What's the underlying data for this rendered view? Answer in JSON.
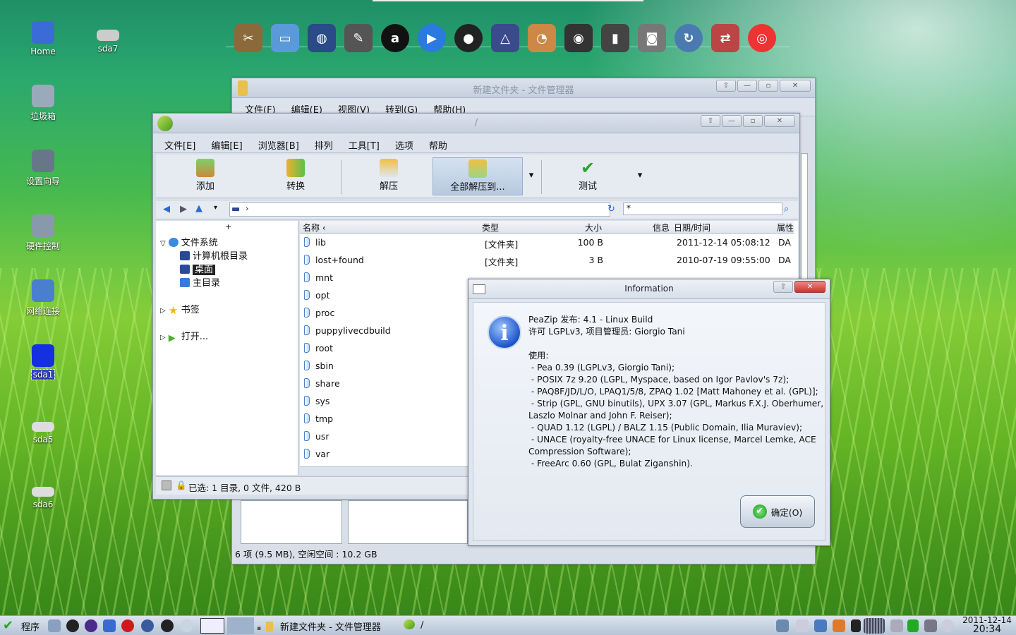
{
  "desktop": {
    "icons": [
      {
        "label": "Home"
      },
      {
        "label": "sda7"
      },
      {
        "label": "垃圾箱"
      },
      {
        "label": "设置向导"
      },
      {
        "label": "硬件控制"
      },
      {
        "label": "网络连接"
      },
      {
        "label": "sda1"
      },
      {
        "label": "sda5"
      },
      {
        "label": "sda6"
      }
    ]
  },
  "file_manager": {
    "title": "新建文件夹 - 文件管理器",
    "menu": [
      "文件(F)",
      "编辑(E)",
      "视图(V)",
      "转到(G)",
      "帮助(H)"
    ],
    "status": "6 项 (9.5 MB), 空闲空间 : 10.2 GB"
  },
  "peazip": {
    "title": "/",
    "menu": [
      "文件[E]",
      "编辑[E]",
      "浏览器[B]",
      "排列",
      "工具[T]",
      "选项",
      "帮助"
    ],
    "toolbar": {
      "add": "添加",
      "convert": "转换",
      "extract": "解压",
      "extract_all": "全部解压到...",
      "test": "测试"
    },
    "filter": "*",
    "tree": {
      "filesystem": "文件系统",
      "root": "计算机根目录",
      "desktop": "桌面",
      "home": "主目录",
      "bookmarks": "书签",
      "open": "打开..."
    },
    "columns": {
      "name": "名称 ‹",
      "type": "类型",
      "size": "大小",
      "info": "信息",
      "date": "日期/时间",
      "attr": "属性"
    },
    "rows": [
      {
        "name": "lib",
        "type": "[文件夹]",
        "size": "100 B",
        "date": "2011-12-14 05:08:12",
        "attr": "DA"
      },
      {
        "name": "lost+found",
        "type": "[文件夹]",
        "size": "3 B",
        "date": "2010-07-19 09:55:00",
        "attr": "DA"
      },
      {
        "name": "mnt",
        "type": "",
        "size": "",
        "date": "",
        "attr": ""
      },
      {
        "name": "opt",
        "type": "",
        "size": "",
        "date": "",
        "attr": ""
      },
      {
        "name": "proc",
        "type": "",
        "size": "",
        "date": "",
        "attr": ""
      },
      {
        "name": "puppylivecdbuild",
        "type": "",
        "size": "",
        "date": "",
        "attr": ""
      },
      {
        "name": "root",
        "type": "",
        "size": "",
        "date": "",
        "attr": ""
      },
      {
        "name": "sbin",
        "type": "",
        "size": "",
        "date": "",
        "attr": ""
      },
      {
        "name": "share",
        "type": "",
        "size": "",
        "date": "",
        "attr": ""
      },
      {
        "name": "sys",
        "type": "",
        "size": "",
        "date": "",
        "attr": ""
      },
      {
        "name": "tmp",
        "type": "",
        "size": "",
        "date": "",
        "attr": ""
      },
      {
        "name": "usr",
        "type": "",
        "size": "",
        "date": "",
        "attr": ""
      },
      {
        "name": "var",
        "type": "",
        "size": "",
        "date": "",
        "attr": ""
      }
    ],
    "status": "已选: 1 目录, 0 文件, 420 B"
  },
  "dialog": {
    "title": "Information",
    "text": "PeaZip 发布: 4.1 - Linux Build\n许可 LGPLv3, 项目管理员: Giorgio Tani\n\n使用:\n - Pea 0.39 (LGPLv3, Giorgio Tani);\n - POSIX 7z 9.20 (LGPL, Myspace, based on Igor Pavlov's 7z);\n - PAQ8F/JD/L/O, LPAQ1/5/8, ZPAQ 1.02 [Matt Mahoney et al. (GPL)];\n - Strip (GPL, GNU binutils), UPX 3.07 (GPL, Markus F.X.J. Oberhumer, Laszlo Molnar and John F. Reiser);\n - QUAD 1.12 (LGPL) / BALZ 1.15 (Public Domain, Ilia Muraviev);\n - UNACE (royalty-free UNACE for Linux license, Marcel Lemke, ACE Compression Software);\n - FreeArc 0.60 (GPL, Bulat Ziganshin).",
    "ok": "确定(O)"
  },
  "taskbar": {
    "start": "程序",
    "task1": "新建文件夹 - 文件管理器",
    "task2": "/",
    "date": "2011-12-14",
    "time": "20:34"
  },
  "colors": {
    "selection": "#3344cc",
    "dialog_icon": "#1d56c9"
  }
}
